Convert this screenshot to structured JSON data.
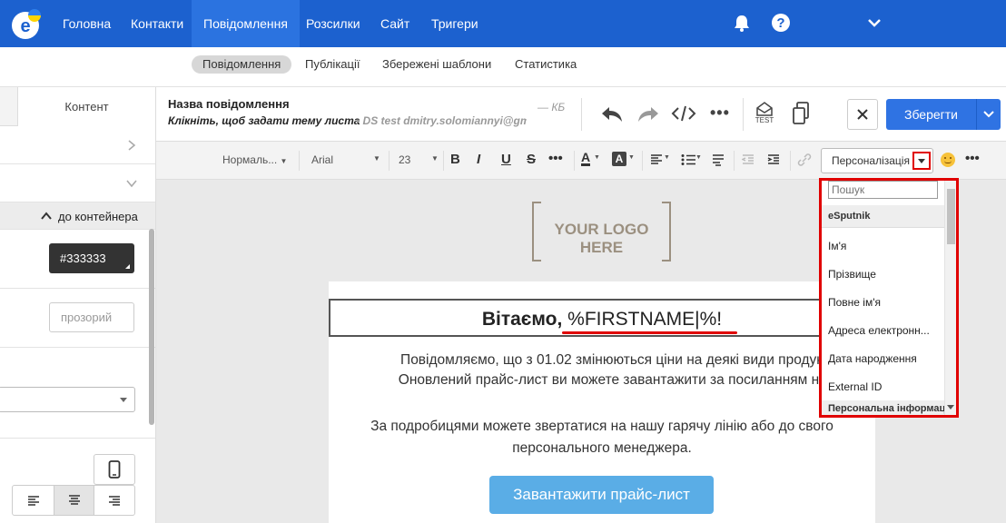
{
  "topnav": {
    "items": [
      "Головна",
      "Контакти",
      "Повідомлення",
      "Розсилки",
      "Сайт",
      "Тригери"
    ],
    "active": "Повідомлення"
  },
  "subnav": {
    "items": [
      "Повідомлення",
      "Публікації",
      "Збережені шаблони",
      "Статистика"
    ],
    "active": "Повідомлення"
  },
  "left_panel": {
    "tab_label": "Контент",
    "container_link": "до контейнера",
    "color_value": "#333333",
    "transparent_label": "прозорий"
  },
  "message": {
    "name_label": "Назва повідомлення",
    "subject_hint": "Клікніть, щоб задати тему листа",
    "size_label": "— КБ",
    "sender": "• DS test dmitry.solomiannyi@gm"
  },
  "toolbar": {
    "test_label": "TEST",
    "save_label": "Зберегти",
    "style_select": "Нормаль...",
    "font_select": "Arial",
    "size_select": "23",
    "personalization_label": "Персоналізація"
  },
  "dropdown": {
    "search_placeholder": "Пошук",
    "group1": "eSputnik",
    "items": [
      "Ім'я",
      "Прізвище",
      "Повне ім'я",
      "Адреса електронн...",
      "Дата народження",
      "External ID"
    ],
    "group2": "Персональна інформац"
  },
  "email": {
    "logo_text": "YOUR LOGO HERE",
    "greeting_bold": "Вітаємо,",
    "greeting_var": "%FIRSTNAME|%!",
    "para1_line1": "Повідомляємо, що з 01.02 змінюються ціни на деякі види продукц",
    "para1_line2": "Оновлений прайс-лист ви можете завантажити за посиланням ниж",
    "para2_line1": "За подробицями можете звертатися на нашу гарячу лінію або до свого",
    "para2_line2": "персонального менеджера.",
    "button_label": "Завантажити прайс-лист"
  },
  "colors": {
    "brand_blue": "#1c61cf",
    "save_blue": "#2f73e3",
    "highlight_red": "#e00000",
    "email_button": "#5aade6"
  }
}
